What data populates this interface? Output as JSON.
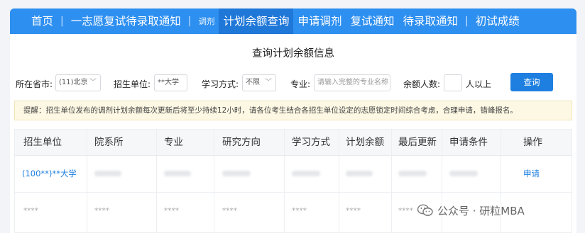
{
  "nav": {
    "items": [
      {
        "label": "首页"
      },
      {
        "label": "一志愿复试待录取通知"
      },
      {
        "label": "调剂"
      },
      {
        "label": "计划余额查询"
      },
      {
        "label": "申请调剂"
      },
      {
        "label": "复试通知"
      },
      {
        "label": "待录取通知"
      },
      {
        "label": "初试成绩"
      }
    ],
    "separator": "|",
    "active_item": "计划余额查询"
  },
  "panel": {
    "title": "查询计划余额信息"
  },
  "filters": {
    "province_label": "所在省市:",
    "province_value": "(11)北京",
    "unit_label": "招生单位:",
    "unit_value": "**大学",
    "mode_label": "学习方式:",
    "mode_value": "不限",
    "major_label": "专业:",
    "major_placeholder": "请输入完整的专业名称",
    "remain_label": "余额人数:",
    "remain_value": "",
    "remain_suffix": "人以上",
    "query_button": "查询"
  },
  "notice": {
    "text": "提醒：招生单位发布的调剂计划余额每次更新后将至少持续12小时，请各位考生结合各招生单位设定的志愿锁定时间综合考虑，合理申请，错峰报名。"
  },
  "table": {
    "columns": [
      "招生单位",
      "院系所",
      "专业",
      "研究方向",
      "学习方式",
      "计划余额",
      "最后更新",
      "申请条件",
      "操作"
    ],
    "rows": [
      {
        "unit": "(100**)**大学",
        "action": "申请"
      },
      {
        "unit": "****",
        "dept": "****",
        "major": "****",
        "direction": "****",
        "mode": "****",
        "remain": "****",
        "updated": "****",
        "action": ""
      }
    ]
  },
  "watermark": {
    "text": "公众号 · 研粒MBA"
  },
  "colors": {
    "nav_bg": "#2d8ff0",
    "nav_active": "#1f77d8",
    "link": "#1e7fe0",
    "notice_bg": "#fdf8e4"
  }
}
